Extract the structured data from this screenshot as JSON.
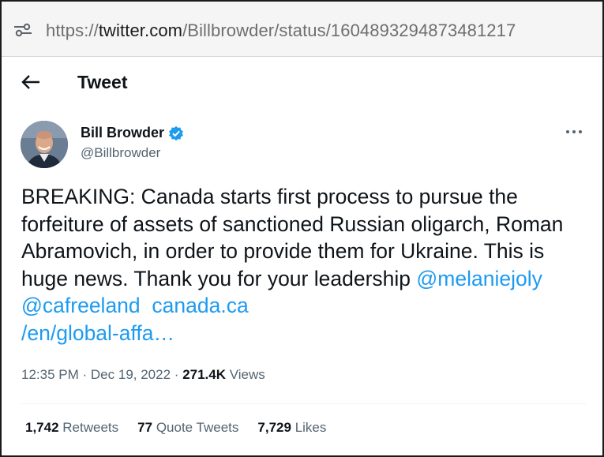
{
  "browser": {
    "url_scheme": "https://",
    "url_host": "twitter.com",
    "url_path": "/Billbrowder/status/1604893294873481217"
  },
  "header": {
    "title": "Tweet"
  },
  "author": {
    "name": "Bill Browder",
    "handle": "@Billbrowder",
    "verified": true
  },
  "tweet": {
    "text": "BREAKING: Canada starts first process to pursue the forfeiture of assets of sanctioned Russian oligarch, Roman Abramovich, in order to provide them for Ukraine. This is huge news. Thank you for your leadership ",
    "mention_1": "@melaniejoly",
    "mention_2": "@cafreeland",
    "link_line_1": "canada.ca",
    "link_line_2": "/en/global-affa…",
    "time": "12:35 PM",
    "date": "Dec 19, 2022",
    "views_count": "271.4K",
    "views_label": "Views",
    "separator": "·"
  },
  "stats": {
    "retweets_count": "1,742",
    "retweets_label": "Retweets",
    "quotes_count": "77",
    "quotes_label": "Quote Tweets",
    "likes_count": "7,729",
    "likes_label": "Likes"
  },
  "colors": {
    "link": "#1d9bf0",
    "secondary_text": "#536471",
    "primary_text": "#0f1419"
  }
}
